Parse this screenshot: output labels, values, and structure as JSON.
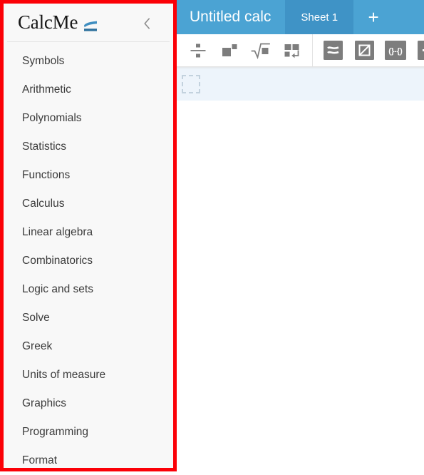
{
  "sidebar": {
    "brand": {
      "name": "CalcMe",
      "mark_icon": "approximately-equal-logo-icon",
      "mark_color": "#3f8ec0"
    },
    "collapse": {
      "icon": "chevron-left-icon",
      "label": "Collapse panel"
    },
    "items": [
      {
        "label": "Symbols"
      },
      {
        "label": "Arithmetic"
      },
      {
        "label": "Polynomials"
      },
      {
        "label": "Statistics"
      },
      {
        "label": "Functions"
      },
      {
        "label": "Calculus"
      },
      {
        "label": "Linear algebra"
      },
      {
        "label": "Combinatorics"
      },
      {
        "label": "Logic and sets"
      },
      {
        "label": "Solve"
      },
      {
        "label": "Greek"
      },
      {
        "label": "Units of measure"
      },
      {
        "label": "Graphics"
      },
      {
        "label": "Programming"
      },
      {
        "label": "Format"
      }
    ],
    "highlight_color": "#fb0007"
  },
  "topbar": {
    "document_title": "Untitled calc",
    "sheet_tab": "Sheet 1",
    "add_sheet_label": "+",
    "background_color": "#4ba3d3",
    "tab_color": "#3f93c6"
  },
  "toolbar": {
    "group_one": [
      {
        "name": "fraction-icon",
        "title": "Fraction"
      },
      {
        "name": "superscript-icon",
        "title": "Power"
      },
      {
        "name": "square-root-icon",
        "title": "Square root"
      },
      {
        "name": "matrix-newline-icon",
        "title": "Matrix"
      }
    ],
    "group_two": [
      {
        "name": "approximately-equal-icon",
        "title": "Approximately equal"
      },
      {
        "name": "strikethrough-square-icon",
        "title": "Hide"
      },
      {
        "name": "interval-icon",
        "title": "Interval"
      },
      {
        "name": "partial-icon",
        "title": "More"
      }
    ],
    "icon_color": "#7d7d7d"
  },
  "editor": {
    "placeholder_name": "empty-math-input",
    "row_background": "#edf4fb"
  }
}
